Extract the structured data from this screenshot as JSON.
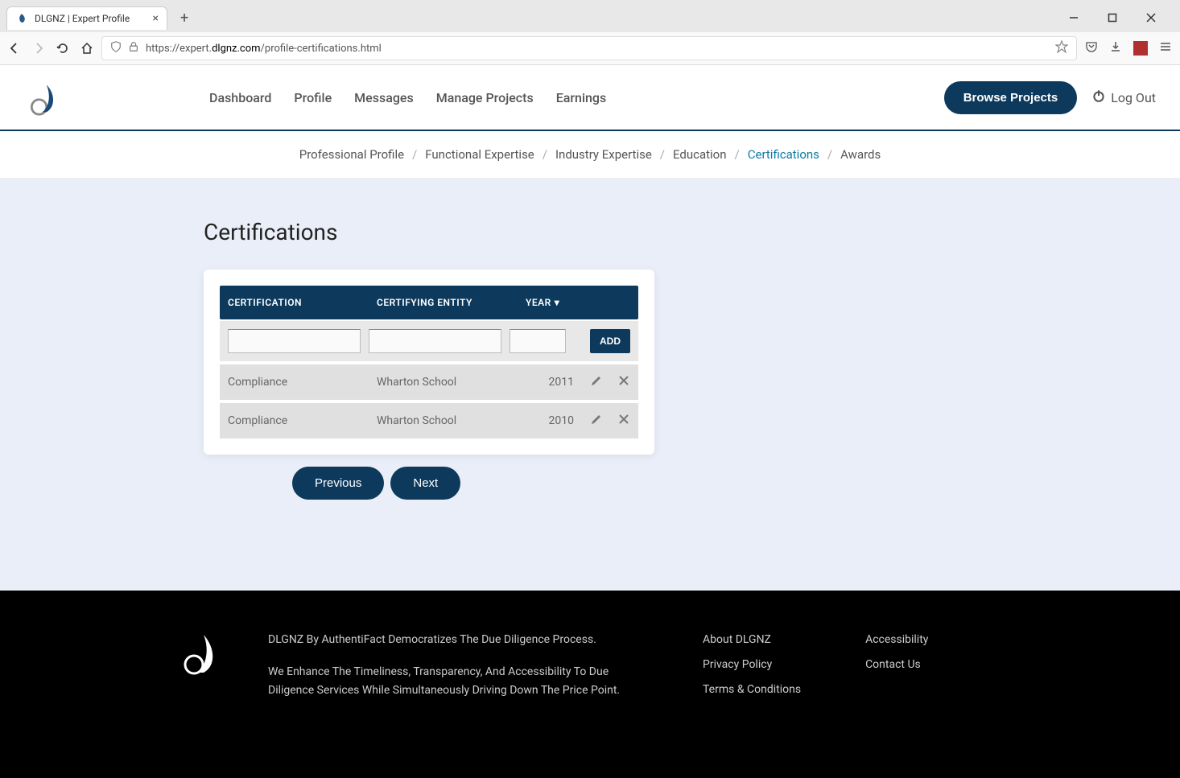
{
  "browser": {
    "tab_title": "DLGNZ | Expert Profile",
    "url_prefix": "https://expert.",
    "url_domain": "dlgnz.com",
    "url_path": "/profile-certifications.html"
  },
  "header": {
    "nav": {
      "dashboard": "Dashboard",
      "profile": "Profile",
      "messages": "Messages",
      "manage_projects": "Manage Projects",
      "earnings": "Earnings"
    },
    "browse_button": "Browse Projects",
    "logout": "Log Out"
  },
  "breadcrumb": {
    "professional_profile": "Professional Profile",
    "functional_expertise": "Functional Expertise",
    "industry_expertise": "Industry Expertise",
    "education": "Education",
    "certifications": "Certifications",
    "awards": "Awards"
  },
  "page": {
    "title": "Certifications"
  },
  "table": {
    "headers": {
      "certification": "CERTIFICATION",
      "entity": "CERTIFYING ENTITY",
      "year": "YEAR"
    },
    "add_button": "ADD",
    "rows": [
      {
        "certification": "Compliance",
        "entity": "Wharton School",
        "year": "2011"
      },
      {
        "certification": "Compliance",
        "entity": "Wharton School",
        "year": "2010"
      }
    ]
  },
  "pager": {
    "previous": "Previous",
    "next": "Next"
  },
  "footer": {
    "line1": "DLGNZ By AuthentiFact Democratizes The Due Diligence Process.",
    "line2": "We Enhance The Timeliness, Transparency, And Accessibility To Due Diligence Services While Simultaneously Driving Down The Price Point.",
    "links_col1": {
      "about": "About DLGNZ",
      "privacy": "Privacy Policy",
      "terms": "Terms & Conditions"
    },
    "links_col2": {
      "accessibility": "Accessibility",
      "contact": "Contact Us"
    }
  }
}
